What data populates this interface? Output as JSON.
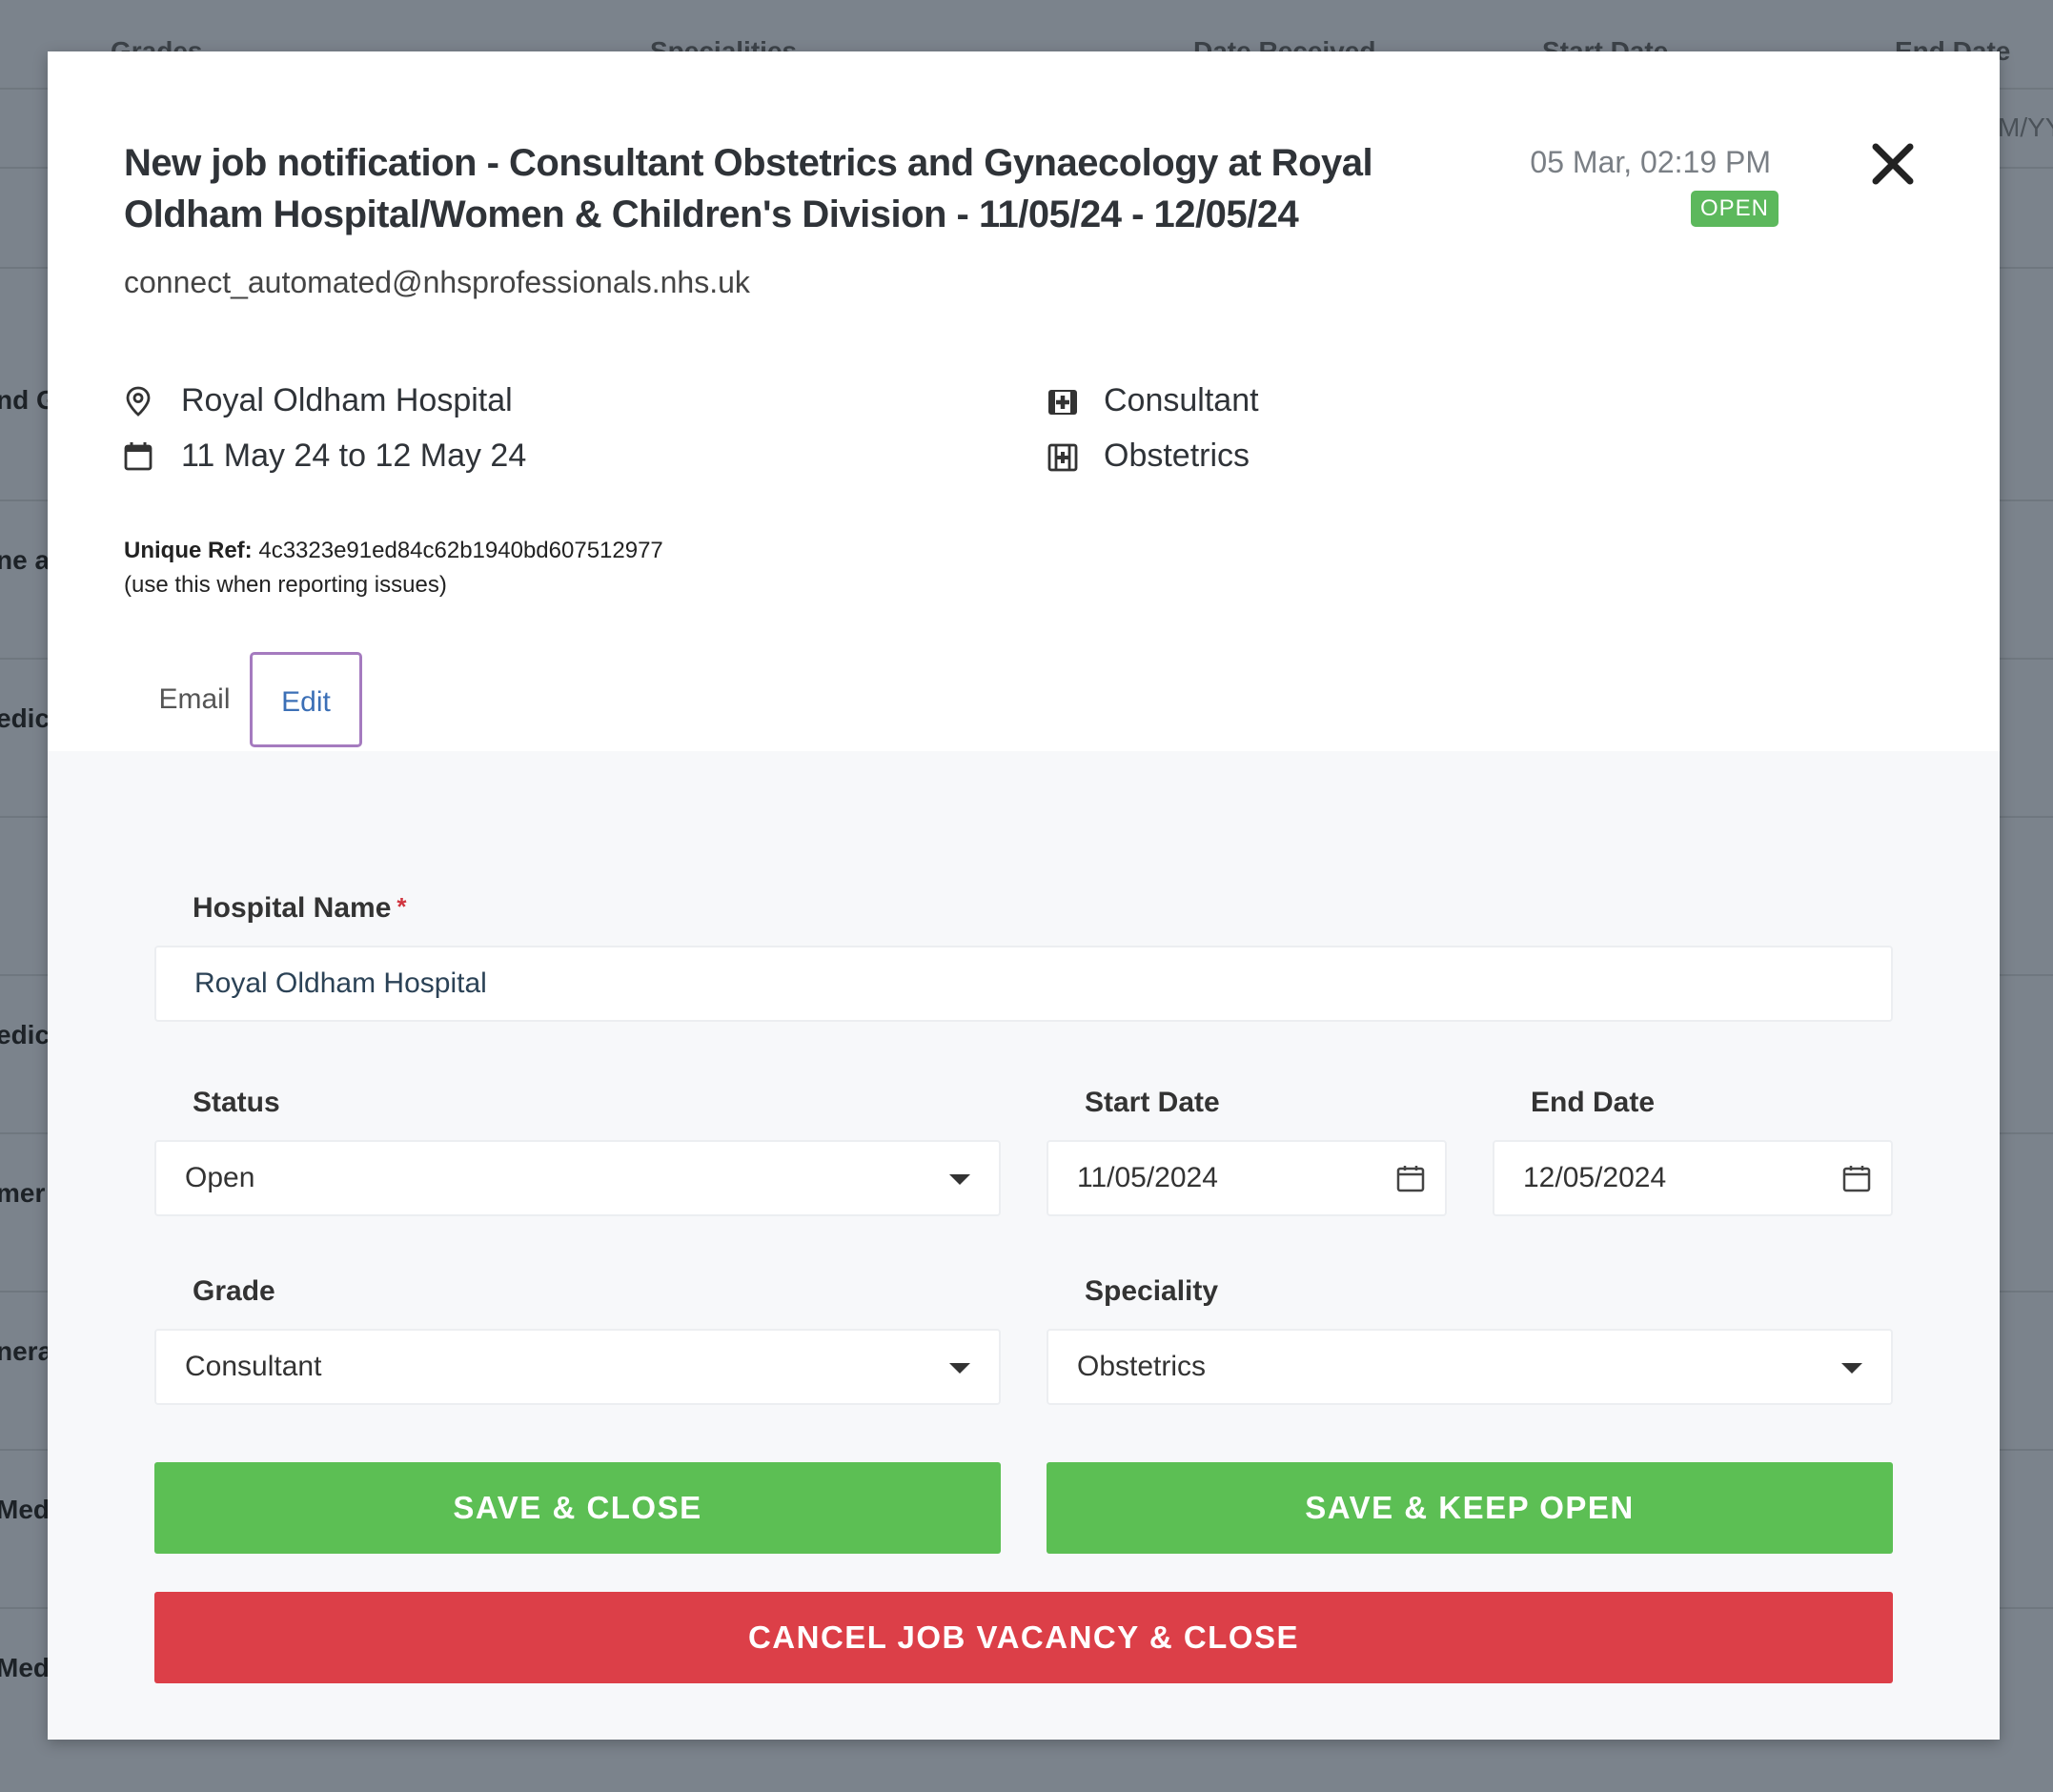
{
  "background": {
    "columns": [
      "Grades",
      "Specialities",
      "Date Received",
      "Start Date",
      "End Date"
    ],
    "right_fragment": "M/YY",
    "row_fragments": [
      "nd G",
      "ne at",
      "edici",
      "edici",
      "mer",
      "nera",
      "Med",
      "Med"
    ]
  },
  "modal": {
    "title": "New job notification - Consultant Obstetrics and Gynaecology at Royal Oldham Hospital/Women & Children's Division - 11/05/24 - 12/05/24",
    "sender": "connect_automated@nhsprofessionals.nhs.uk",
    "timestamp": "05 Mar, 02:19 PM",
    "status_badge": "OPEN",
    "info": {
      "location": "Royal Oldham Hospital",
      "dates": "11 May 24 to 12 May 24",
      "grade": "Consultant",
      "speciality": "Obstetrics"
    },
    "unique_ref_label": "Unique Ref:",
    "unique_ref_value": "4c3323e91ed84c62b1940bd607512977",
    "unique_ref_note": "(use this when reporting issues)",
    "tabs": [
      {
        "label": "Email",
        "active": false
      },
      {
        "label": "Edit",
        "active": true
      }
    ],
    "icons": {
      "close": "close-icon",
      "location": "map-pin-icon",
      "dates": "calendar-icon",
      "grade": "medical-kit-icon",
      "speciality": "medical-plus-icon"
    }
  },
  "form": {
    "hospital_label": "Hospital Name",
    "required_mark": "*",
    "hospital_value": "Royal Oldham Hospital",
    "status_label": "Status",
    "status_value": "Open",
    "start_label": "Start Date",
    "start_value": "11/05/2024",
    "end_label": "End Date",
    "end_value": "12/05/2024",
    "grade_label": "Grade",
    "grade_value": "Consultant",
    "speciality_label": "Speciality",
    "speciality_value": "Obstetrics"
  },
  "buttons": {
    "save_close": "SAVE & CLOSE",
    "save_keep_open": "SAVE & KEEP OPEN",
    "cancel_vacancy": "CANCEL JOB VACANCY & CLOSE"
  },
  "colors": {
    "green": "#5cbf54",
    "red": "#dc3f48",
    "badge_green": "#5cb85c",
    "active_tab_border": "#a57bbf",
    "active_tab_text": "#3b6fb6"
  }
}
